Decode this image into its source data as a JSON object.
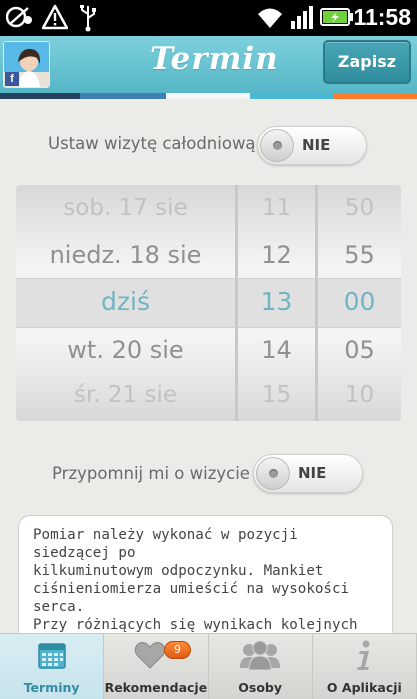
{
  "status_bar": {
    "time": "11:58",
    "icons": [
      "notification-icon",
      "alert-icon",
      "usb-icon",
      "wifi-icon",
      "signal-icon",
      "battery-charging-icon"
    ]
  },
  "header": {
    "title": "Termin",
    "save_label": "Zapisz",
    "avatar_badge": "f"
  },
  "colors": {
    "header": "#62c0cf",
    "strip": [
      "#1f3a5c",
      "#4a9fd0",
      "#ffffff",
      "#2aa7c2",
      "#ff7b2a"
    ],
    "accent": "#2aa7c2"
  },
  "all_day": {
    "label": "Ustaw wizytę całodniową",
    "value": "NIE"
  },
  "picker": {
    "dates": [
      "sob. 17 sie",
      "niedz. 18 sie",
      "dziś",
      "wt. 20 sie",
      "śr. 21 sie"
    ],
    "hours": [
      "11",
      "12",
      "13",
      "14",
      "15"
    ],
    "minutes": [
      "50",
      "55",
      "00",
      "05",
      "10"
    ]
  },
  "reminder": {
    "label": "Przypomnij mi o wizycie",
    "value": "NIE"
  },
  "note": {
    "text": "Pomiar należy wykonać w pozycji siedzącej po\nkilkuminutowym odpoczynku. Mankiet\nciśnieniomierza umieścić na wysokości serca.\nPrzy różniących się wynikach kolejnych\npomiarów uwzględniać wynik wyższy."
  },
  "tabs": [
    {
      "label": "Terminy",
      "icon": "calendar-icon"
    },
    {
      "label": "Rekomendacje",
      "icon": "heart-icon",
      "badge": "9"
    },
    {
      "label": "Osoby",
      "icon": "people-icon"
    },
    {
      "label": "O Aplikacji",
      "icon": "info-icon"
    }
  ]
}
